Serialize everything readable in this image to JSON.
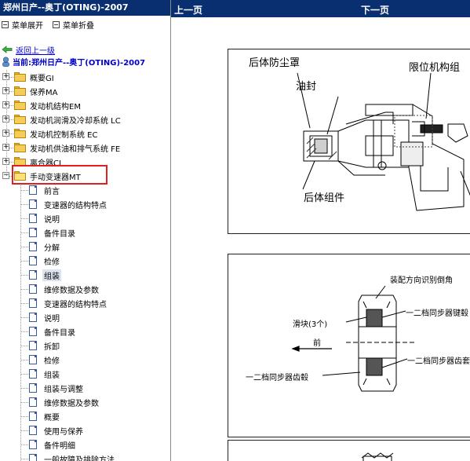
{
  "left_pane": {
    "title": "郑州日产--奥丁(OTING)-2007",
    "controls": {
      "expand": "菜单展开",
      "collapse": "菜单折叠"
    },
    "back_link": "返回上一级",
    "current": "当前:郑州日产--奥丁(OTING)-2007",
    "categories": [
      {
        "label": "概要GI",
        "expander": "+"
      },
      {
        "label": "保养MA",
        "expander": "+"
      },
      {
        "label": "发动机结构EM",
        "expander": "+"
      },
      {
        "label": "发动机润滑及冷却系统 LC",
        "expander": "+"
      },
      {
        "label": "发动机控制系统 EC",
        "expander": "+"
      },
      {
        "label": "发动机供油和排气系统 FE",
        "expander": "+"
      },
      {
        "label": "离合器CL",
        "expander": "+"
      },
      {
        "label": "手动变速器MT",
        "expander": "−"
      }
    ],
    "mt_items": [
      "前言",
      "变速器的结构特点",
      "说明",
      "备件目录",
      "分解",
      "检修",
      "组装",
      "维修数据及参数",
      "变速器的结构特点",
      "说明",
      "备件目录",
      "拆卸",
      "检修",
      "组装",
      "组装与调整",
      "维修数据及参数",
      "概要",
      "使用与保养",
      "备件明细",
      "一般故障及排除方法"
    ],
    "active_item_index": 6
  },
  "right_pane": {
    "prev": "上一页",
    "next": "下一页",
    "fig1": {
      "labels": {
        "dust_cover": "后体防尘罩",
        "limit": "限位机构组",
        "oil_seal": "油封",
        "rear_body": "后体组件"
      }
    },
    "fig2": {
      "labels": {
        "direction": "装配方向识别倒角",
        "slider": "滑块(3个)",
        "front": "前",
        "sync_key": "一二档同步器键毂",
        "sync_sleeve": "一二档同步器齿套",
        "sync_hub": "一二档同步器齿毂"
      }
    }
  },
  "colors": {
    "title_bar": "#0a2f70",
    "link": "#0000cc",
    "highlight_box": "#e02020"
  }
}
